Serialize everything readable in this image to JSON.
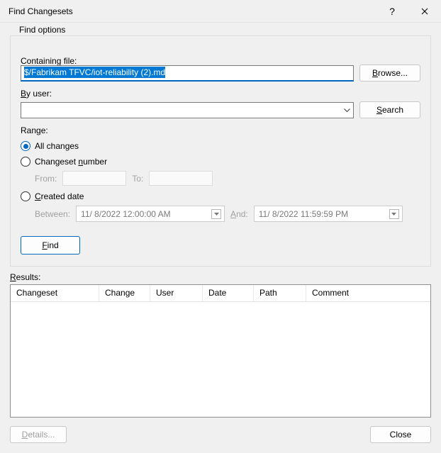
{
  "titlebar": {
    "title": "Find Changesets"
  },
  "group": {
    "legend": "Find options",
    "containing_file_label": "Containing file:",
    "containing_file_value": "$/Fabrikam TFVC/iot-reliability (2).md",
    "browse_label": "Browse...",
    "by_user_label": "By user:",
    "by_user_value": "",
    "search_label": "Search",
    "range_label": "Range:",
    "radio_all": "All changes",
    "radio_number": "Changeset number",
    "from_label": "From:",
    "to_label": "To:",
    "radio_created": "Created date",
    "between_label": "Between:",
    "and_label": "And:",
    "between_value": "11/  8/2022 12:00:00 AM",
    "and_value": "11/  8/2022 11:59:59 PM",
    "find_btn": "Find"
  },
  "results": {
    "label": "Results:",
    "columns": {
      "changeset": "Changeset",
      "change": "Change",
      "user": "User",
      "date": "Date",
      "path": "Path",
      "comment": "Comment"
    }
  },
  "bottom": {
    "details": "Details...",
    "close": "Close"
  }
}
